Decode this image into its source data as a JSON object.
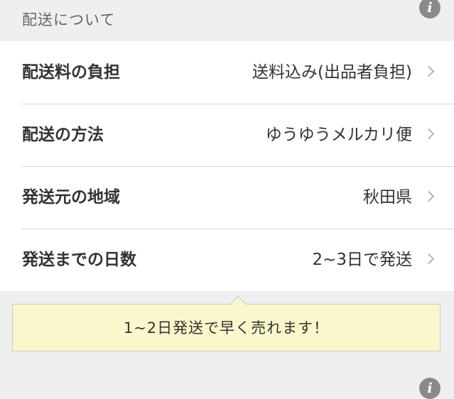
{
  "section": {
    "title": "配送について",
    "info_icon_glyph": "i"
  },
  "rows": [
    {
      "label": "配送料の負担",
      "value": "送料込み(出品者負担)"
    },
    {
      "label": "配送の方法",
      "value": "ゆうゆうメルカリ便"
    },
    {
      "label": "発送元の地域",
      "value": "秋田県"
    },
    {
      "label": "発送までの日数",
      "value": "2~3日で発送"
    }
  ],
  "tooltip": {
    "text": "1~2日発送で早く売れます！"
  },
  "next_section": {
    "info_icon_glyph": "i"
  },
  "colors": {
    "background": "#efefef",
    "tooltip_background": "#fbf7cc",
    "icon_gray": "#8a8a8a"
  }
}
